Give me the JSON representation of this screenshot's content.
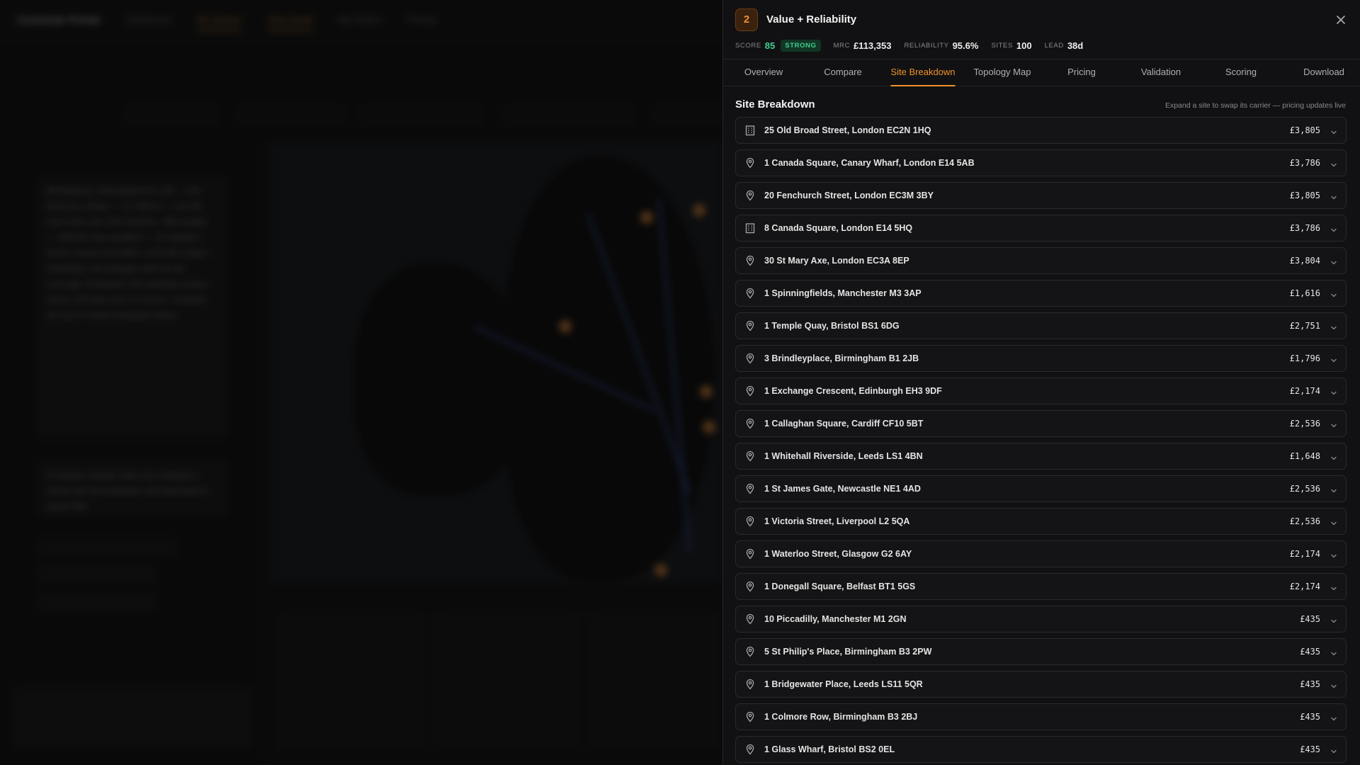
{
  "background": {
    "brand": "Customer Portal",
    "nav": [
      "Dashboard",
      "My Quotes",
      "New Quote",
      "My Orders",
      "Pricing"
    ],
    "messages": [
      "Brindleplace, Birmingham B1 2JB — DIA Business 1Gbps — £1,796/mo — and 98 more sites over 100 locations. 488 insights — 100/100 sites qualified — 18 suppliers found. Lowest total MRC: £113,353 (Value + Reliability). All strategies with full site coverage. Evaluated 165 candidate quotes across 100 sites and 14 carriers. Compare the top 10 ranked strategies below.",
      "10 quotes created. Open any strategy to review the full breakdown and download its quote PDF."
    ]
  },
  "panel": {
    "rank": "2",
    "title": "Value + Reliability",
    "metrics": {
      "score_label": "SCORE",
      "score_value": "85",
      "badge": "STRONG",
      "mrc_label": "MRC",
      "mrc_value": "£113,353",
      "reliability_label": "RELIABILITY",
      "reliability_value": "95.6%",
      "sites_label": "SITES",
      "sites_value": "100",
      "lead_label": "LEAD",
      "lead_value": "38d"
    },
    "tabs": [
      "Overview",
      "Compare",
      "Site Breakdown",
      "Topology Map",
      "Pricing",
      "Validation",
      "Scoring",
      "Download"
    ],
    "active_tab": "Site Breakdown",
    "section_title": "Site Breakdown",
    "section_hint": "Expand a site to swap its carrier — pricing updates live",
    "sites": [
      {
        "address": "25 Old Broad Street, London EC2N 1HQ",
        "price": "£3,805",
        "icon": "building-icon"
      },
      {
        "address": "1 Canada Square, Canary Wharf, London E14 5AB",
        "price": "£3,786",
        "icon": "location-pin-icon"
      },
      {
        "address": "20 Fenchurch Street, London EC3M 3BY",
        "price": "£3,805",
        "icon": "location-pin-icon"
      },
      {
        "address": "8 Canada Square, London E14 5HQ",
        "price": "£3,786",
        "icon": "building-icon"
      },
      {
        "address": "30 St Mary Axe, London EC3A 8EP",
        "price": "£3,804",
        "icon": "location-pin-icon"
      },
      {
        "address": "1 Spinningfields, Manchester M3 3AP",
        "price": "£1,616",
        "icon": "location-pin-icon"
      },
      {
        "address": "1 Temple Quay, Bristol BS1 6DG",
        "price": "£2,751",
        "icon": "location-pin-icon"
      },
      {
        "address": "3 Brindleyplace, Birmingham B1 2JB",
        "price": "£1,796",
        "icon": "location-pin-icon"
      },
      {
        "address": "1 Exchange Crescent, Edinburgh EH3 9DF",
        "price": "£2,174",
        "icon": "location-pin-icon"
      },
      {
        "address": "1 Callaghan Square, Cardiff CF10 5BT",
        "price": "£2,536",
        "icon": "location-pin-icon"
      },
      {
        "address": "1 Whitehall Riverside, Leeds LS1 4BN",
        "price": "£1,648",
        "icon": "location-pin-icon"
      },
      {
        "address": "1 St James Gate, Newcastle NE1 4AD",
        "price": "£2,536",
        "icon": "location-pin-icon"
      },
      {
        "address": "1 Victoria Street, Liverpool L2 5QA",
        "price": "£2,536",
        "icon": "location-pin-icon"
      },
      {
        "address": "1 Waterloo Street, Glasgow G2 6AY",
        "price": "£2,174",
        "icon": "location-pin-icon"
      },
      {
        "address": "1 Donegall Square, Belfast BT1 5GS",
        "price": "£2,174",
        "icon": "location-pin-icon"
      },
      {
        "address": "10 Piccadilly, Manchester M1 2GN",
        "price": "£435",
        "icon": "location-pin-icon"
      },
      {
        "address": "5 St Philip's Place, Birmingham B3 2PW",
        "price": "£435",
        "icon": "location-pin-icon"
      },
      {
        "address": "1 Bridgewater Place, Leeds LS11 5QR",
        "price": "£435",
        "icon": "location-pin-icon"
      },
      {
        "address": "1 Colmore Row, Birmingham B3 2BJ",
        "price": "£435",
        "icon": "location-pin-icon"
      },
      {
        "address": "1 Glass Wharf, Bristol BS2 0EL",
        "price": "£435",
        "icon": "location-pin-icon"
      }
    ]
  },
  "colors": {
    "accent": "#f0932b",
    "strong_green": "#3ecf8e",
    "panel_bg": "#111113",
    "row_bg": "#141416"
  }
}
